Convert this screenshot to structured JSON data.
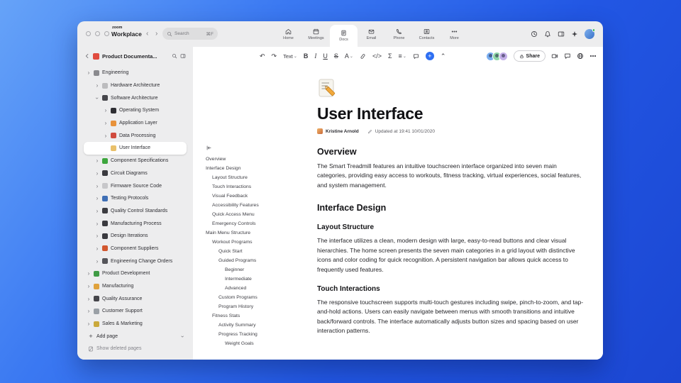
{
  "titlebar": {
    "brand_top": "zoom",
    "brand_bottom": "Workplace",
    "search": {
      "placeholder": "Search",
      "shortcut": "⌘F"
    },
    "tabs": [
      {
        "label": "Home",
        "icon": "home",
        "active": false
      },
      {
        "label": "Meetings",
        "icon": "calendar",
        "active": false
      },
      {
        "label": "Docs",
        "icon": "docs",
        "active": true
      },
      {
        "label": "Email",
        "icon": "mail",
        "active": false
      },
      {
        "label": "Phone",
        "icon": "phone",
        "active": false
      },
      {
        "label": "Contacts",
        "icon": "contacts",
        "active": false
      },
      {
        "label": "More",
        "icon": "more",
        "active": false
      }
    ],
    "right_icons": [
      "history-icon",
      "notifications-icon",
      "sidebar-toggle-icon",
      "ai-companion-icon"
    ]
  },
  "sidebar": {
    "workspace": {
      "label": "Product Documenta...",
      "icon": "rocket-icon",
      "icon_color": "#e04b3f"
    },
    "tree": [
      {
        "label": "Engineering",
        "level": 0,
        "chevron": "right",
        "icon": "gear-icon",
        "icon_color": "#8a8a8e"
      },
      {
        "label": "Hardware Architecture",
        "level": 1,
        "chevron": "right",
        "icon": "hardware-icon",
        "icon_color": "#bcbcbe"
      },
      {
        "label": "Software Architecture",
        "level": 1,
        "chevron": "down",
        "icon": "laptop-icon",
        "icon_color": "#47474c"
      },
      {
        "label": "Operating System",
        "level": 2,
        "chevron": "right",
        "icon": "device-icon",
        "icon_color": "#2e2e33"
      },
      {
        "label": "Application Layer",
        "level": 2,
        "chevron": "right",
        "icon": "orange-book-icon",
        "icon_color": "#e8923a"
      },
      {
        "label": "Data Processing",
        "level": 2,
        "chevron": "right",
        "icon": "chart-icon",
        "icon_color": "#d04b3e"
      },
      {
        "label": "User Interface",
        "level": 2,
        "chevron": "none",
        "icon": "memo-icon",
        "icon_color": "#e9c06a",
        "selected": true
      },
      {
        "label": "Component Specifications",
        "level": 1,
        "chevron": "right",
        "icon": "clover-icon",
        "icon_color": "#3da63d"
      },
      {
        "label": "Circuit Diagrams",
        "level": 1,
        "chevron": "right",
        "icon": "party-popper-icon",
        "icon_color": "#3a3a3f"
      },
      {
        "label": "Firmware Source Code",
        "level": 1,
        "chevron": "right",
        "icon": "bone-icon",
        "icon_color": "#c7c7ca"
      },
      {
        "label": "Testing Protocols",
        "level": 1,
        "chevron": "right",
        "icon": "officer-icon",
        "icon_color": "#3f6fb5"
      },
      {
        "label": "Quality Control Standards",
        "level": 1,
        "chevron": "right",
        "icon": "traffic-light-icon",
        "icon_color": "#3c3c41"
      },
      {
        "label": "Manufacturing Process",
        "level": 1,
        "chevron": "right",
        "icon": "leg-icon",
        "icon_color": "#3a3a3f"
      },
      {
        "label": "Design Iterations",
        "level": 1,
        "chevron": "right",
        "icon": "camera-icon",
        "icon_color": "#3a3a3f"
      },
      {
        "label": "Component Suppliers",
        "level": 1,
        "chevron": "right",
        "icon": "truck-icon",
        "icon_color": "#d2572f"
      },
      {
        "label": "Engineering Change Orders",
        "level": 1,
        "chevron": "right",
        "icon": "dark-sphere-icon",
        "icon_color": "#55555a"
      },
      {
        "label": "Product Development",
        "level": 0,
        "chevron": "right",
        "icon": "green-pen-icon",
        "icon_color": "#3f9b45"
      },
      {
        "label": "Manufacturing",
        "level": 0,
        "chevron": "right",
        "icon": "worker-icon",
        "icon_color": "#e0a23c"
      },
      {
        "label": "Quality Assurance",
        "level": 0,
        "chevron": "right",
        "icon": "microscope-icon",
        "icon_color": "#45454a"
      },
      {
        "label": "Customer Support",
        "level": 0,
        "chevron": "right",
        "icon": "speech-bubble-icon",
        "icon_color": "#9aa0a6"
      },
      {
        "label": "Sales & Marketing",
        "level": 0,
        "chevron": "right",
        "icon": "projector-icon",
        "icon_color": "#caa93c"
      }
    ],
    "add_page": "Add page",
    "show_deleted": "Show deleted pages"
  },
  "outline": {
    "items": [
      {
        "label": "Overview",
        "level": 0
      },
      {
        "label": "Interface Design",
        "level": 0
      },
      {
        "label": "Layout Structure",
        "level": 1
      },
      {
        "label": "Touch Interactions",
        "level": 1
      },
      {
        "label": "Visual Feedback",
        "level": 1
      },
      {
        "label": "Accessibility Features",
        "level": 1
      },
      {
        "label": "Quick Access Menu",
        "level": 1
      },
      {
        "label": "Emergency Controls",
        "level": 1
      },
      {
        "label": "Main Menu Structure",
        "level": 0
      },
      {
        "label": "Workout Programs",
        "level": 1
      },
      {
        "label": "Quick Start",
        "level": 2
      },
      {
        "label": "Guided Programs",
        "level": 2
      },
      {
        "label": "Beginner",
        "level": 3
      },
      {
        "label": "Intermediate",
        "level": 3
      },
      {
        "label": "Advanced",
        "level": 3
      },
      {
        "label": "Custom Programs",
        "level": 2
      },
      {
        "label": "Program History",
        "level": 2
      },
      {
        "label": "Fitness Stats",
        "level": 1
      },
      {
        "label": "Activity Summary",
        "level": 2
      },
      {
        "label": "Progress Tracking",
        "level": 2
      },
      {
        "label": "Weight Goals",
        "level": 3
      }
    ]
  },
  "toolbar": {
    "items": [
      {
        "name": "undo-button",
        "glyph": "↶"
      },
      {
        "name": "redo-button",
        "glyph": "↷"
      },
      {
        "name": "text-style-dropdown",
        "glyph": "Text",
        "chevron": true
      },
      {
        "name": "bold-button",
        "glyph": "B"
      },
      {
        "name": "italic-button",
        "glyph": "I"
      },
      {
        "name": "underline-button",
        "glyph": "U"
      },
      {
        "name": "strikethrough-button",
        "glyph": "S"
      },
      {
        "name": "text-color-button",
        "glyph": "A",
        "chevron": true
      },
      {
        "name": "link-button",
        "icon": "link"
      },
      {
        "name": "code-button",
        "glyph": "</>"
      },
      {
        "name": "equation-button",
        "glyph": "Σ"
      },
      {
        "name": "align-button",
        "glyph": "≡",
        "chevron": true
      },
      {
        "name": "comment-button",
        "icon": "chat"
      },
      {
        "name": "insert-button",
        "glyph": "+"
      },
      {
        "name": "collapse-toolbar-button",
        "glyph": "⌃"
      }
    ],
    "collaborator_colors": [
      "#79aef0",
      "#8fd6a8",
      "#c3afe8"
    ],
    "share_label": "Share",
    "right_icons": [
      "video-icon",
      "chat-panel-icon",
      "globe-icon",
      "more-options-icon"
    ]
  },
  "doc": {
    "icon": "memo-emoji",
    "title": "User Interface",
    "author": "Kristine Arnold",
    "updated": "Updated at 19:41 10/01/2020",
    "sections": [
      {
        "type": "h2",
        "text": "Overview"
      },
      {
        "type": "p",
        "text": "The Smart Treadmill features an intuitive touchscreen interface organized into seven main categories, providing easy access to workouts, fitness tracking, virtual experiences, social features, and system management."
      },
      {
        "type": "h2",
        "text": "Interface Design"
      },
      {
        "type": "h3",
        "text": "Layout Structure"
      },
      {
        "type": "p",
        "text": "The interface utilizes a clean, modern design with large, easy-to-read buttons and clear visual hierarchies. The home screen presents the seven main categories in a grid layout with distinctive icons and color coding for quick recognition. A persistent navigation bar allows quick access to frequently used features."
      },
      {
        "type": "h3",
        "text": "Touch Interactions"
      },
      {
        "type": "p",
        "text": "The responsive touchscreen supports multi-touch gestures including swipe, pinch-to-zoom, and tap-and-hold actions. Users can easily navigate between menus with smooth transitions and intuitive back/forward controls. The interface automatically adjusts button sizes and spacing based on user interaction patterns."
      }
    ]
  }
}
